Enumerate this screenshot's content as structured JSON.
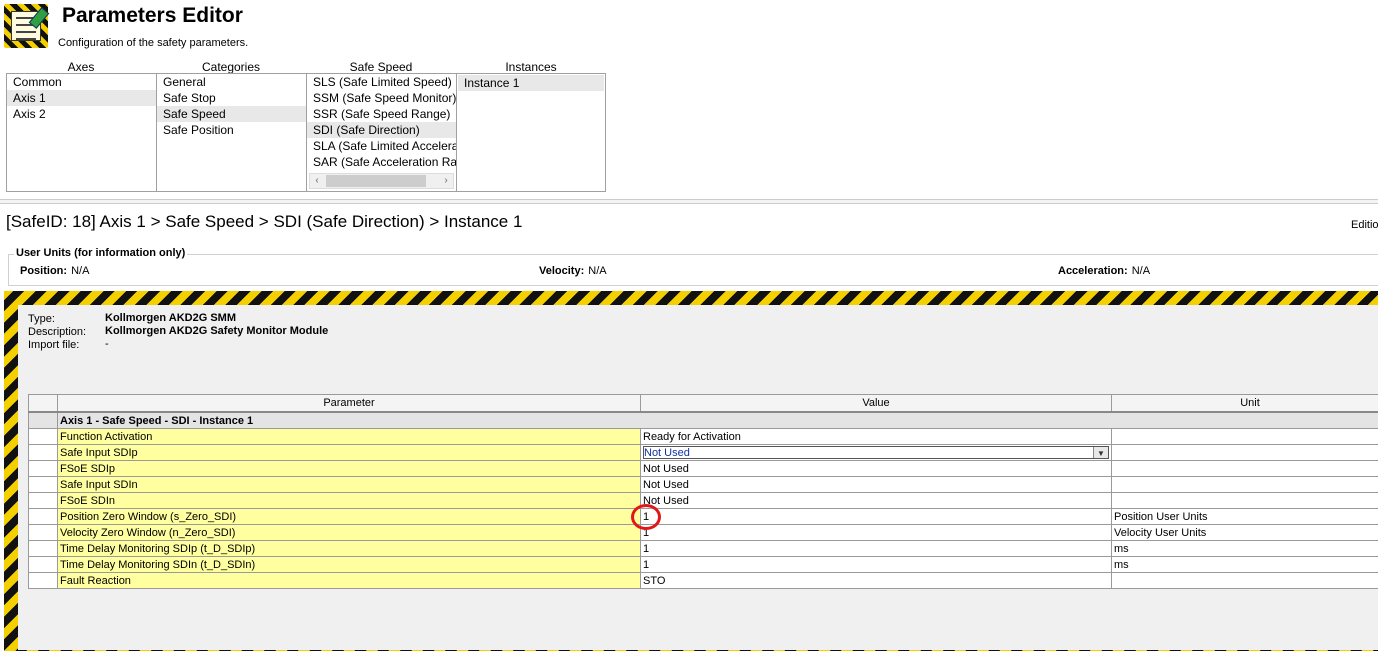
{
  "header": {
    "title": "Parameters Editor",
    "subtitle": "Configuration of the safety parameters."
  },
  "columns": {
    "axes": {
      "label": "Axes",
      "items": [
        "Common",
        "Axis 1",
        "Axis 2"
      ]
    },
    "categories": {
      "label": "Categories",
      "items": [
        "General",
        "Safe Stop",
        "Safe Speed",
        "Safe Position"
      ]
    },
    "safe_speed": {
      "label": "Safe Speed",
      "items": [
        "SLS (Safe Limited Speed)",
        "SSM (Safe Speed Monitor)",
        "SSR (Safe Speed Range)",
        "SDI (Safe Direction)",
        "SLA (Safe Limited Acceleration)",
        "SAR (Safe Acceleration Range)"
      ]
    },
    "instances": {
      "label": "Instances",
      "items": [
        "Instance 1"
      ]
    }
  },
  "breadcrumb": "[SafeID: 18]  Axis 1 > Safe Speed > SDI (Safe Direction) > Instance 1",
  "edition_label": "Editio",
  "user_units": {
    "legend": "User Units (for information only)",
    "position_label": "Position:",
    "position_value": "N/A",
    "velocity_label": "Velocity:",
    "velocity_value": "N/A",
    "acceleration_label": "Acceleration:",
    "acceleration_value": "N/A"
  },
  "device": {
    "type_label": "Type:",
    "type_value": "Kollmorgen AKD2G SMM",
    "description_label": "Description:",
    "description_value": "Kollmorgen AKD2G Safety Monitor Module",
    "import_label": "Import file:",
    "import_value": "-"
  },
  "grid": {
    "headers": {
      "parameter": "Parameter",
      "value": "Value",
      "unit": "Unit"
    },
    "group": "Axis 1 - Safe Speed - SDI - Instance 1",
    "rows": [
      {
        "parameter": "Function Activation",
        "value": "Ready for Activation",
        "unit": ""
      },
      {
        "parameter": "Safe Input SDIp",
        "value": "Not Used",
        "unit": ""
      },
      {
        "parameter": "FSoE SDIp",
        "value": "Not Used",
        "unit": ""
      },
      {
        "parameter": "Safe Input SDIn",
        "value": "Not Used",
        "unit": ""
      },
      {
        "parameter": "FSoE SDIn",
        "value": "Not Used",
        "unit": ""
      },
      {
        "parameter": "Position Zero Window (s_Zero_SDI)",
        "value": "1",
        "unit": "Position User Units"
      },
      {
        "parameter": "Velocity Zero Window (n_Zero_SDI)",
        "value": "1",
        "unit": "Velocity User Units"
      },
      {
        "parameter": "Time Delay Monitoring SDIp (t_D_SDIp)",
        "value": "1",
        "unit": "ms"
      },
      {
        "parameter": "Time Delay Monitoring SDIn (t_D_SDIn)",
        "value": "1",
        "unit": "ms"
      },
      {
        "parameter": "Fault Reaction",
        "value": "STO",
        "unit": ""
      }
    ]
  },
  "colors": {
    "hazard_yellow": "#f4d000",
    "param_bg": "#ffffa0",
    "highlight": "#e0181a"
  }
}
